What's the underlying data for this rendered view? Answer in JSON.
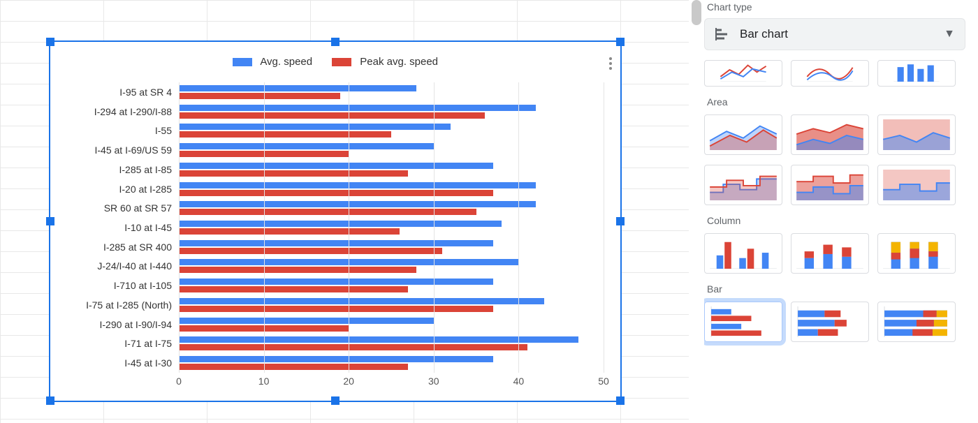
{
  "panel": {
    "label": "Chart type",
    "select_value": "Bar chart",
    "sections": {
      "area": "Area",
      "column": "Column",
      "bar": "Bar"
    }
  },
  "colors": {
    "series_a": "#4285f4",
    "series_b": "#db4437"
  },
  "chart_data": {
    "type": "bar",
    "orientation": "horizontal",
    "legend": {
      "position": "top",
      "entries": [
        "Avg. speed",
        "Peak avg. speed"
      ]
    },
    "xlabel": "",
    "ylabel": "",
    "xlim": [
      0,
      50
    ],
    "x_ticks": [
      0,
      10,
      20,
      30,
      40,
      50
    ],
    "categories": [
      "I-95 at SR 4",
      "I-294 at I-290/I-88",
      "I-55",
      "I-45 at I-69/US 59",
      "I-285 at I-85",
      "I-20 at I-285",
      "SR 60 at SR 57",
      "I-10 at I-45",
      "I-285 at SR 400",
      "J-24/I-40 at I-440",
      "I-710 at I-105",
      "I-75 at I-285 (North)",
      "I-290 at I-90/I-94",
      "I-71 at I-75",
      "I-45 at I-30"
    ],
    "series": [
      {
        "name": "Avg. speed",
        "values": [
          28,
          42,
          32,
          30,
          37,
          42,
          42,
          38,
          37,
          40,
          37,
          43,
          30,
          47,
          37
        ]
      },
      {
        "name": "Peak avg. speed",
        "values": [
          19,
          36,
          25,
          20,
          27,
          37,
          35,
          26,
          31,
          28,
          27,
          37,
          20,
          41,
          27
        ]
      }
    ]
  }
}
